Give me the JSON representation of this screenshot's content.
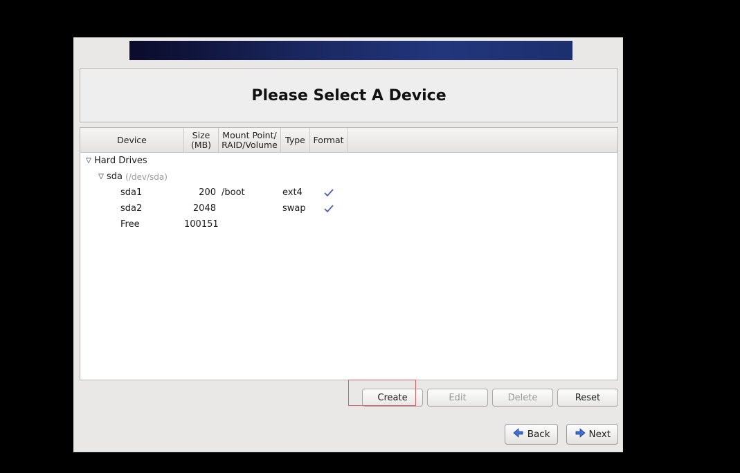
{
  "title": "Please Select A Device",
  "columns": {
    "device": "Device",
    "size": "Size\n(MB)",
    "mount": "Mount Point/\nRAID/Volume",
    "type": "Type",
    "format": "Format"
  },
  "tree": {
    "root_label": "Hard Drives",
    "disk": {
      "name": "sda",
      "path": "(/dev/sda)"
    },
    "rows": [
      {
        "device": "sda1",
        "size": "200",
        "mount": "/boot",
        "type": "ext4",
        "format": true
      },
      {
        "device": "sda2",
        "size": "2048",
        "mount": "",
        "type": "swap",
        "format": true
      },
      {
        "device": "Free",
        "size": "100151",
        "mount": "",
        "type": "",
        "format": false
      }
    ]
  },
  "buttons": {
    "create": "Create",
    "edit": "Edit",
    "delete": "Delete",
    "reset": "Reset"
  },
  "nav": {
    "back": "Back",
    "next": "Next"
  }
}
